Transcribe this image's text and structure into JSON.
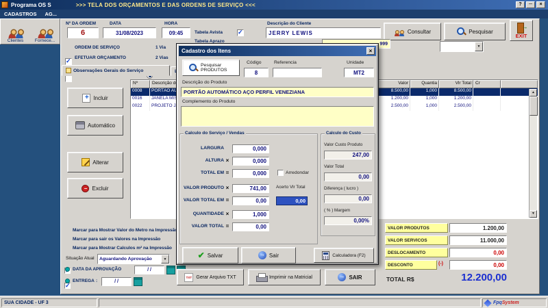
{
  "window": {
    "app_title": "Programa OS S",
    "title": ">>>  TELA DOS ORÇAMENTOS E DAS ORDENS DE SERVIÇO  <<<",
    "btn_help": "?",
    "btn_min": "─",
    "btn_close": "×"
  },
  "menu": {
    "item1": "CADASTROS",
    "item2": "AG..."
  },
  "toolbar": {
    "clientes": "Clientes",
    "fornecedores": "Fornece...",
    "exit": "EXIT"
  },
  "form": {
    "ordem_label": "Nº DA ORDEM",
    "ordem": "6",
    "data_label": "DATA",
    "data": "31/08/2023",
    "hora_label": "HORA",
    "hora": "09:45",
    "tabela_avista": "Tabela Avista",
    "tabela_aprazo": "Tabela Aprazo",
    "ordem_servico": "ORDEM DE SERVIÇO",
    "efetuar_orcamento": "EFETUAR ORÇAMENTO",
    "via1": "1 Via",
    "via2": "2 Vias",
    "cliente_label": "Descrição do Cliente",
    "cliente": "JERRY LEWIS",
    "consultar": "Consultar",
    "pesquisar": "Pesquisar",
    "codigo_cliente": "999"
  },
  "tabs": {
    "tab1": "Observações Gerais do Serviço",
    "tab2": "Lista de Produtos"
  },
  "actions": {
    "incluir": "Incluir",
    "automatico": "Automático",
    "alterar": "Alterar",
    "excluir": "Excluir"
  },
  "table": {
    "headers": [
      "Nº",
      "Descrição do Produto",
      "Valor",
      "Quantia",
      "Vlr Total",
      "Cr"
    ],
    "rows": [
      {
        "num": "0008",
        "desc": "PORTÃO AUTOMÁTICO AÇO PERFIL VENEZIANA",
        "valor": "8.500,00",
        "quantia": "1,000",
        "total": "8.500,00",
        "selected": true
      },
      {
        "num": "0016",
        "desc": "JANELA MISTA",
        "valor": "1.200,00",
        "quantia": "1,000",
        "total": "1.200,00",
        "selected": false
      },
      {
        "num": "0022",
        "desc": "PROJETO JANE",
        "valor": "2.500,00",
        "quantia": "1,000",
        "total": "2.500,00",
        "selected": false
      }
    ]
  },
  "print_options": {
    "opt1": "Marcar para Mostrar Valor do Metro na Impressão",
    "opt2": "Marcar para sair os Valores na Impressão",
    "opt3": "Marcar para Mostrar Calculos m² na Impressão"
  },
  "situacao": {
    "label": "Situação Atual",
    "value": "Aguardando Aprovação"
  },
  "datas": {
    "aprovacao_label": "DATA DA APROVAÇÃO",
    "aprovacao": "/  /",
    "entrega_label": "ENTREGA",
    "entrega_sep": ":",
    "entrega": "/  /"
  },
  "totals": {
    "produtos_label": "VALOR PRODUTOS",
    "produtos": "1.200,00",
    "servicos_label": "VALOR SERVICOS",
    "servicos": "11.000,00",
    "deslocamento_label": "DESLOCAMENTO",
    "deslocamento": "0,00",
    "desconto_label": "DESCONTO",
    "desconto_sign": "(-)",
    "desconto": "0,00",
    "total_label": "TOTAL R$",
    "total": "12.200,00"
  },
  "bottom": {
    "txt": "Gerar Arquivo TXT",
    "matricial": "Imprimir na Matricial",
    "sair": "SAIR"
  },
  "statusbar": {
    "city": "SUA CIDADE - UF 3",
    "brand_a": "Fpq",
    "brand_b": "System"
  },
  "modal": {
    "title": "Cadastro dos Itens",
    "btn_close": "×",
    "pesquisar_produtos": "Pesquisar PRODUTOS",
    "codigo_label": "Código",
    "codigo": "8",
    "referencia_label": "Referencia",
    "referencia": "",
    "unidade_label": "Unidade",
    "unidade": "MT2",
    "descricao_label": "Descrição do Produto",
    "descricao": "PORTÃO AUTOMÁTICO AÇO PERFIL VENEZIANA",
    "complemento_label": "Complemento do Produto",
    "complemento": "",
    "vendas": {
      "title": "Calculo do Serviço / Vendas",
      "largura_label": "LARGURA",
      "largura": "0,000",
      "altura_label": "ALTURA",
      "altura": "0,000",
      "total_em_label": "TOTAL EM",
      "total_em": "0,000",
      "arredondar_label": "Arredondar",
      "valor_produto_label": "VALOR PRODUTO",
      "valor_produto": "741,00",
      "acerto_label": "Acerto Vlr Total",
      "acerto": "0,00",
      "valor_total_em_label": "VALOR TOTAL EM",
      "valor_total_em": "0,00",
      "quantidade_label": "QUANTIDADE",
      "quantidade": "1,000",
      "valor_total_label": "VALOR TOTAL",
      "valor_total": "0,00",
      "op_x": "×",
      "op_eq": "="
    },
    "custo": {
      "title": "Calculo do Custo",
      "custo_produto_label": "Valor Custo Produto",
      "custo_produto": "247,00",
      "valor_total_label": "Valor Total",
      "valor_total": "0,00",
      "diferenca_label": "Diferença ( lucro )",
      "diferenca": "0,00",
      "margem_label": "( % ) Margem",
      "margem": "0,00%"
    },
    "buttons": {
      "salvar": "Salvar",
      "sair": "Sair",
      "calculadora": "Calculadora  (F2)"
    }
  }
}
